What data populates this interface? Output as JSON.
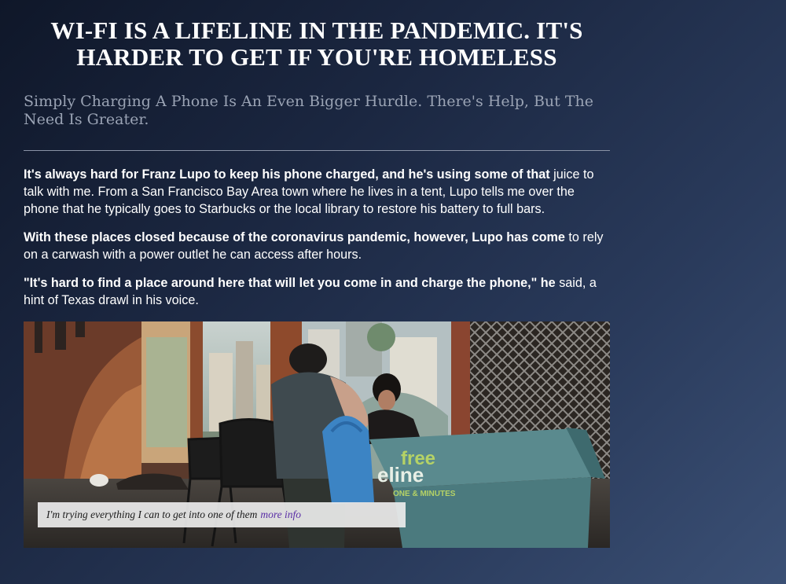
{
  "article": {
    "headline_line1": "WI-FI IS A LIFELINE IN THE PANDEMIC. IT'S",
    "headline_line2": "HARDER TO GET IF YOU'RE HOMELESS",
    "subheadline": "Simply Charging A Phone Is An Even Bigger Hurdle. There's Help, But The Need Is Greater.",
    "paragraphs": [
      {
        "bold": "It's always hard for Franz Lupo to keep his phone charged, and he's using some of that",
        "rest": " juice to talk with me. From a San Francisco Bay Area town where he lives in a tent, Lupo tells me over the phone that he typically goes to Starbucks or the local library to restore his battery to full bars."
      },
      {
        "bold": "With these places closed because of the coronavirus pandemic, however, Lupo has come",
        "rest": " to rely on a carwash with a power outlet he can access after hours."
      },
      {
        "bold": "\"It's hard to find a place around here that will let you come in and charge the phone,\" he",
        "rest": " said, a hint of Texas drawl in his voice."
      }
    ],
    "photo": {
      "tablecloth_text_1": "free",
      "tablecloth_text_2": "eline",
      "tablecloth_text_3": "ONE & MINUTES",
      "caption": "I'm trying everything I can to get into one of them",
      "caption_link": "more info"
    }
  }
}
